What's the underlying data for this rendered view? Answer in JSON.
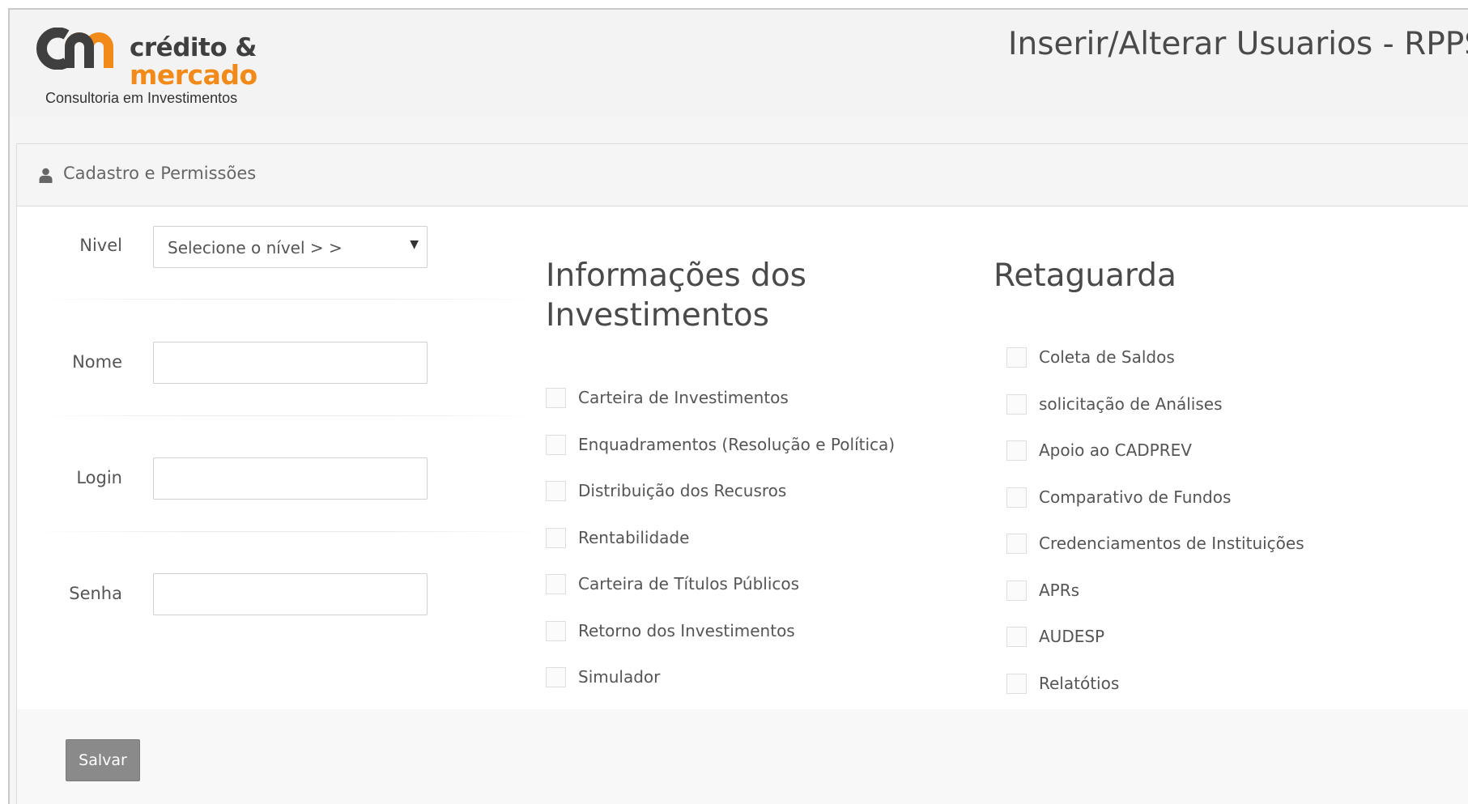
{
  "logo": {
    "top_text": "crédito &",
    "bottom_text": "mercado",
    "tagline": "Consultoria em Investimentos"
  },
  "header": {
    "title": "Inserir/Alterar Usuarios - RPPS"
  },
  "panel": {
    "heading_icon": "user-icon",
    "heading": "Cadastro e Permissões"
  },
  "form": {
    "nivel_label": "Nivel",
    "nivel_selected": "Selecione o nível > >",
    "nome_label": "Nome",
    "nome_value": "",
    "login_label": "Login",
    "login_value": "",
    "senha_label": "Senha",
    "senha_value": ""
  },
  "investimentos": {
    "title": "Informações dos Investimentos",
    "items": [
      {
        "label": "Carteira de Investimentos",
        "checked": false
      },
      {
        "label": "Enquadramentos (Resolução e Política)",
        "checked": false
      },
      {
        "label": "Distribuição dos Recusros",
        "checked": false
      },
      {
        "label": "Rentabilidade",
        "checked": false
      },
      {
        "label": "Carteira de Títulos Públicos",
        "checked": false
      },
      {
        "label": "Retorno dos Investimentos",
        "checked": false
      },
      {
        "label": "Simulador",
        "checked": false
      }
    ]
  },
  "retaguarda": {
    "title": "Retaguarda",
    "items": [
      {
        "label": "Coleta de Saldos",
        "checked": false
      },
      {
        "label": "solicitação de Análises",
        "checked": false
      },
      {
        "label": "Apoio ao CADPREV",
        "checked": false
      },
      {
        "label": "Comparativo de Fundos",
        "checked": false
      },
      {
        "label": "Credenciamentos de Instituições",
        "checked": false
      },
      {
        "label": "APRs",
        "checked": false
      },
      {
        "label": "AUDESP",
        "checked": false
      },
      {
        "label": "Relatótios",
        "checked": false
      }
    ]
  },
  "actions": {
    "save_label": "Salvar"
  },
  "colors": {
    "brand_dark": "#3f3f3f",
    "brand_orange": "#f28a1a",
    "button_gray": "#8a8a8a"
  }
}
